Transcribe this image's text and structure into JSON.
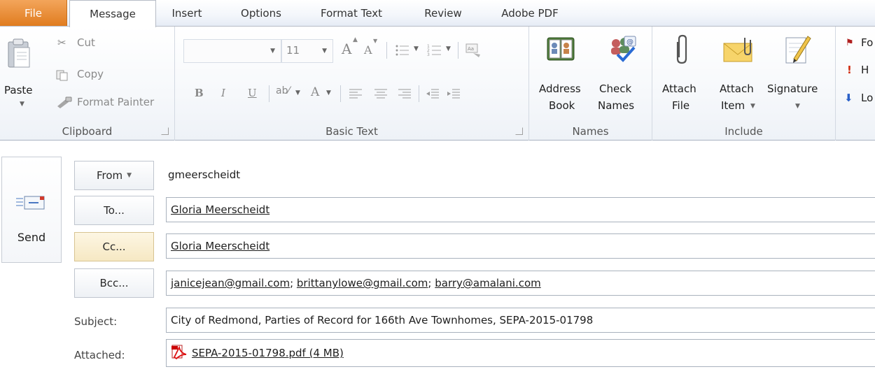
{
  "tabs": [
    {
      "label": "File"
    },
    {
      "label": "Message"
    },
    {
      "label": "Insert"
    },
    {
      "label": "Options"
    },
    {
      "label": "Format Text"
    },
    {
      "label": "Review"
    },
    {
      "label": "Adobe PDF"
    }
  ],
  "clipboard": {
    "paste_label": "Paste",
    "cut_label": "Cut",
    "copy_label": "Copy",
    "format_painter_label": "Format Painter",
    "group_label": "Clipboard"
  },
  "basic_text": {
    "font_name": "",
    "font_size": "11",
    "grow_font": "A",
    "shrink_font": "A",
    "bold": "B",
    "italic": "I",
    "underline": "U",
    "font_color": "A",
    "group_label": "Basic Text"
  },
  "names": {
    "address_book_line1": "Address",
    "address_book_line2": "Book",
    "check_names_line1": "Check",
    "check_names_line2": "Names",
    "group_label": "Names"
  },
  "include": {
    "attach_file_line1": "Attach",
    "attach_file_line2": "File",
    "attach_item_line1": "Attach",
    "attach_item_line2": "Item",
    "signature_label": "Signature",
    "group_label": "Include"
  },
  "tags": {
    "follow_up_partial": "Fo",
    "high_importance_partial": "H",
    "low_importance_partial": "Lo"
  },
  "compose": {
    "send_label": "Send",
    "from_button": "From",
    "from_value": "gmeerscheidt",
    "to_button": "To...",
    "to_value": "Gloria Meerscheidt",
    "cc_button": "Cc...",
    "cc_value": "Gloria Meerscheidt",
    "bcc_button": "Bcc...",
    "bcc_recipients": [
      "janicejean@gmail.com",
      "brittanylowe@gmail.com",
      "barry@amalani.com"
    ],
    "subject_label": "Subject:",
    "subject_value": "City of Redmond, Parties of Record for 166th Ave Townhomes, SEPA-2015-01798",
    "attached_label": "Attached:",
    "attachment_name": "SEPA-2015-01798.pdf (4 MB)"
  },
  "colors": {
    "file_tab": "#e07c1f",
    "cc_highlight": "#f6e8c3",
    "ribbon_bg": "#f6f8fb"
  }
}
